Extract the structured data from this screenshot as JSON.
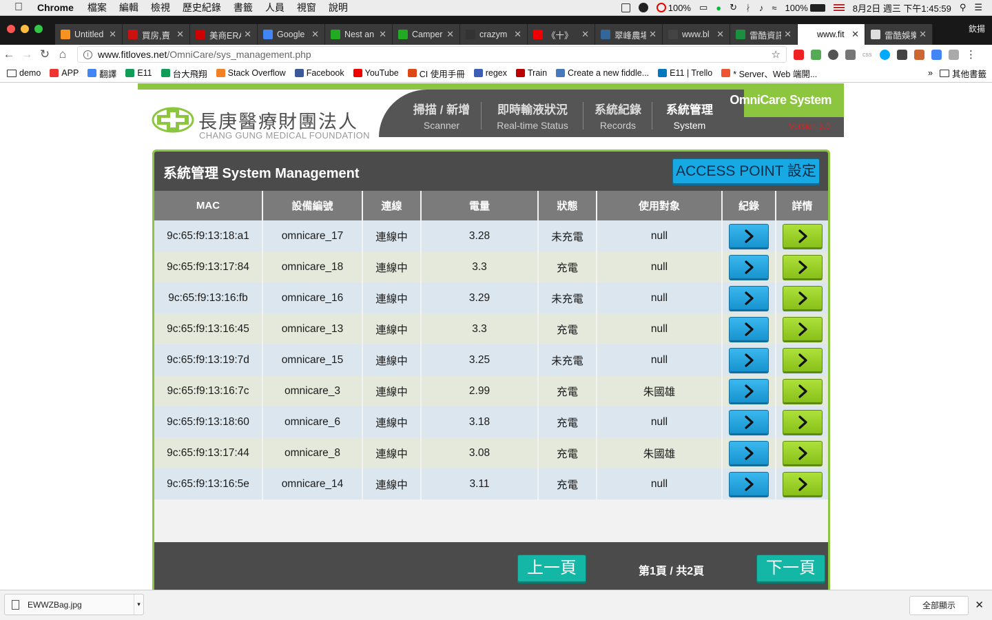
{
  "menubar": {
    "app": "Chrome",
    "items": [
      "檔案",
      "編輯",
      "檢視",
      "歷史紀錄",
      "書籤",
      "人員",
      "視窗",
      "說明"
    ],
    "cpu": "100%",
    "battery": "100%",
    "datetime": "8月2日 週三 下午1:45:59"
  },
  "tabs": [
    {
      "title": "Untitled",
      "color": "#f7931e"
    },
    {
      "title": "買房,賣",
      "color": "#c11"
    },
    {
      "title": "美商ERA",
      "color": "#c00"
    },
    {
      "title": "Google",
      "color": "#4285f4"
    },
    {
      "title": "Nest an",
      "color": "#2a2"
    },
    {
      "title": "Camper",
      "color": "#2a2"
    },
    {
      "title": "crazym",
      "color": "#333"
    },
    {
      "title": "《十》",
      "color": "#e00"
    },
    {
      "title": "翠峰農場",
      "color": "#369"
    },
    {
      "title": "www.bl",
      "color": "#444"
    },
    {
      "title": "雷酷資訊",
      "color": "#1a8f3e"
    },
    {
      "title": "www.fit",
      "color": "#fff",
      "active": true
    },
    {
      "title": "雷酷娛樂",
      "color": "#ddd"
    }
  ],
  "profile": "欽揚",
  "address": {
    "domain": "www.fitloves.net",
    "path": "/OmniCare/sys_management.php"
  },
  "bookmarks": [
    {
      "label": "demo",
      "type": "folder"
    },
    {
      "label": "APP",
      "color": "#e33"
    },
    {
      "label": "翻譯",
      "color": "#4285f4"
    },
    {
      "label": "E11",
      "color": "#0f9d58"
    },
    {
      "label": "台大飛翔",
      "color": "#0f9d58"
    },
    {
      "label": "Stack Overflow",
      "color": "#f48024"
    },
    {
      "label": "Facebook",
      "color": "#3b5998"
    },
    {
      "label": "YouTube",
      "color": "#e00"
    },
    {
      "label": "CI 使用手冊",
      "color": "#dd4814"
    },
    {
      "label": "regex",
      "color": "#3c5eb5"
    },
    {
      "label": "Train",
      "color": "#b00"
    },
    {
      "label": "Create a new fiddle...",
      "color": "#4679bd"
    },
    {
      "label": "E11 | Trello",
      "color": "#0079bf"
    },
    {
      "label": "* Server、Web 端開...",
      "color": "#e53"
    }
  ],
  "bookmarks_more": "»",
  "bookmarks_other": "其他書籤",
  "site": {
    "logo_zh": "長庚醫療財團法人",
    "logo_en": "CHANG GUNG MEDICAL FOUNDATION",
    "nav": [
      {
        "zh": "掃描 / 新增",
        "en": "Scanner"
      },
      {
        "zh": "即時輸液狀況",
        "en": "Real-time Status"
      },
      {
        "zh": "系統紀錄",
        "en": "Records"
      },
      {
        "zh": "系統管理",
        "en": "System",
        "selected": true
      }
    ],
    "brand": "OmniCare System",
    "version": "Version 3.0"
  },
  "panel": {
    "title": "系統管理 System Management",
    "ap_button": "ACCESS POINT 設定",
    "columns": [
      "MAC",
      "設備編號",
      "連線",
      "電量",
      "狀態",
      "使用對象",
      "紀錄",
      "詳情"
    ],
    "rows": [
      {
        "mac": "9c:65:f9:13:18:a1",
        "device": "omnicare_17",
        "conn": "連線中",
        "battery": "3.28",
        "status": "未充電",
        "user": "null"
      },
      {
        "mac": "9c:65:f9:13:17:84",
        "device": "omnicare_18",
        "conn": "連線中",
        "battery": "3.3",
        "status": "充電",
        "user": "null"
      },
      {
        "mac": "9c:65:f9:13:16:fb",
        "device": "omnicare_16",
        "conn": "連線中",
        "battery": "3.29",
        "status": "未充電",
        "user": "null"
      },
      {
        "mac": "9c:65:f9:13:16:45",
        "device": "omnicare_13",
        "conn": "連線中",
        "battery": "3.3",
        "status": "充電",
        "user": "null"
      },
      {
        "mac": "9c:65:f9:13:19:7d",
        "device": "omnicare_15",
        "conn": "連線中",
        "battery": "3.25",
        "status": "未充電",
        "user": "null"
      },
      {
        "mac": "9c:65:f9:13:16:7c",
        "device": "omnicare_3",
        "conn": "連線中",
        "battery": "2.99",
        "status": "充電",
        "user": "朱國雄"
      },
      {
        "mac": "9c:65:f9:13:18:60",
        "device": "omnicare_6",
        "conn": "連線中",
        "battery": "3.18",
        "status": "充電",
        "user": "null"
      },
      {
        "mac": "9c:65:f9:13:17:44",
        "device": "omnicare_8",
        "conn": "連線中",
        "battery": "3.08",
        "status": "充電",
        "user": "朱國雄"
      },
      {
        "mac": "9c:65:f9:13:16:5e",
        "device": "omnicare_14",
        "conn": "連線中",
        "battery": "3.11",
        "status": "充電",
        "user": "null"
      }
    ],
    "prev": "上一頁",
    "next": "下一頁",
    "page_info": "第1頁 / 共2頁"
  },
  "download": {
    "file": "EWWZBag.jpg",
    "show_all": "全部顯示"
  },
  "colors": {
    "accent_green": "#8cc63e",
    "panel_dark": "#4b4b4b",
    "button_blue": "#16a9e4",
    "button_teal": "#14b7a6",
    "version_red": "#d22"
  }
}
